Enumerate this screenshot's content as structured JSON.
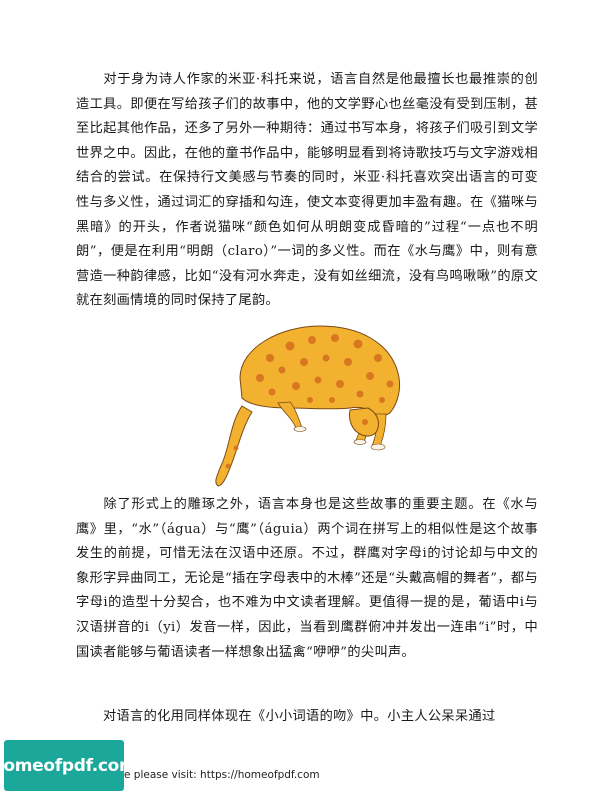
{
  "paragraphs": [
    "对于身为诗人作家的米亚·科托来说，语言自然是他最擅长也最推崇的创造工具。即便在写给孩子们的故事中，他的文学野心也丝毫没有受到压制，甚至比起其他作品，还多了另外一种期待：通过书写本身，将孩子们吸引到文学世界之中。因此，在他的童书作品中，能够明显看到将诗歌技巧与文字游戏相结合的尝试。在保持行文美感与节奏的同时，米亚·科托喜欢突出语言的可变性与多义性，通过词汇的穿插和勾连，使文本变得更加丰盈有趣。在《猫咪与黑暗》的开头，作者说猫咪“颜色如何从明朗变成昏暗的”过程“一点也不明朗”，便是在利用“明朗（claro）”一词的多义性。而在《水与鹰》中，则有意营造一种韵律感，比如“没有河水奔走，没有如丝细流，没有鸟鸣啾啾”的原文就在刻画情境的同时保持了尾韵。",
    "除了形式上的雕琢之外，语言本身也是这些故事的重要主题。在《水与鹰》里，“水”（água）与“鹰”（águia）两个词在拼写上的相似性是这个故事发生的前提，可惜无法在汉语中还原。不过，群鹰对字母i的讨论却与中文的象形字异曲同工，无论是“插在字母表中的木棒”还是“头戴高帽的舞者”，都与字母i的造型十分契合，也不难为中文读者理解。更值得一提的是，葡语中i与汉语拼音的i（yi）发音一样，因此，当看到鹰群俯冲并发出一连串“i”时，中国读者能够与葡语读者一样想象出猛禽“咿咿”的尖叫声。",
    "对语言的化用同样体现在《小小词语的吻》中。小主人公呆呆通过"
  ],
  "illustration": {
    "subject": "spotted-cat-illustration",
    "colors": {
      "fur": "#f2b230",
      "spots": "#d9771f",
      "outline": "#7a4a15"
    }
  },
  "watermark": {
    "logo_text": "homeofpdf.com",
    "footer_text": "e please visit: https://homeofpdf.com",
    "color": "#1ba89a"
  }
}
